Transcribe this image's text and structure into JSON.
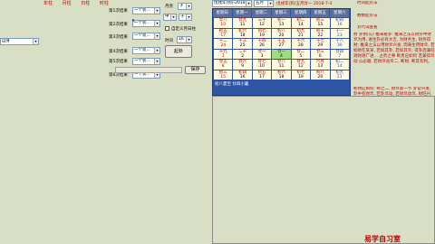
{
  "top_labels": [
    "年柱",
    "月柱",
    "日柱",
    "时柱"
  ],
  "self_select": "自身",
  "rows": [
    {
      "label": "第1次结果",
      "value": "一个装..."
    },
    {
      "label": "第2次结果",
      "value": "一个装..."
    },
    {
      "label": "第3次结果",
      "value": "一个装..."
    },
    {
      "label": "第4次结果",
      "value": "一个装..."
    },
    {
      "label": "第5次结果",
      "value": "一个装..."
    },
    {
      "label": "第6次结果",
      "value": "一个装..."
    }
  ],
  "month_label": "月亮",
  "month_value": "子",
  "day_value": "申",
  "day2_value": "子",
  "custom_checkbox": "自定义月日柱",
  "hour_label": "时间",
  "hour_value": "16",
  "qigua_button": "起卦",
  "save_button": "保存",
  "calendar": {
    "year_select": "戊戌年(狗)-2018",
    "month_select": "五月",
    "header_text": "戊戌年(狗)五月廿一  2018-7-4",
    "weekdays": [
      "星期日",
      "星期一",
      "星期二",
      "星期三",
      "星期四",
      "星期五",
      "星期六"
    ],
    "cells": [
      {
        "l": "廿八",
        "d": "10"
      },
      {
        "l": "廿九",
        "d": "11"
      },
      {
        "l": "三十",
        "d": "12"
      },
      {
        "l": "初一",
        "d": "13"
      },
      {
        "l": "初二",
        "d": "14"
      },
      {
        "l": "初三",
        "d": "15"
      },
      {
        "l": "初四",
        "d": "16"
      },
      {
        "l": "初五",
        "d": "17"
      },
      {
        "l": "初六",
        "d": "18"
      },
      {
        "l": "初七",
        "d": "19"
      },
      {
        "l": "初八",
        "d": "20"
      },
      {
        "l": "初九",
        "d": "21"
      },
      {
        "l": "初十",
        "d": "22"
      },
      {
        "l": "十一",
        "d": "23"
      },
      {
        "l": "十二",
        "d": "24"
      },
      {
        "l": "十三",
        "d": "25"
      },
      {
        "l": "十四",
        "d": "26"
      },
      {
        "l": "十五",
        "d": "27"
      },
      {
        "l": "十六",
        "d": "28"
      },
      {
        "l": "十七",
        "d": "29"
      },
      {
        "l": "十八",
        "d": "30"
      },
      {
        "l": "十九",
        "d": "1"
      },
      {
        "l": "二十",
        "d": "2"
      },
      {
        "l": "廿一",
        "d": "3"
      },
      {
        "l": "廿一",
        "d": "4"
      },
      {
        "l": "廿二",
        "d": "5"
      },
      {
        "l": "廿三",
        "d": "6"
      },
      {
        "l": "廿四",
        "d": "7"
      },
      {
        "l": "廿五",
        "d": "8"
      },
      {
        "l": "廿六",
        "d": "9"
      },
      {
        "l": "廿七",
        "d": "10"
      },
      {
        "l": "廿八",
        "d": "11"
      },
      {
        "l": "廿九",
        "d": "12"
      },
      {
        "l": "六月",
        "d": "13"
      },
      {
        "l": "初二",
        "d": "14"
      },
      {
        "l": "初三",
        "d": "15"
      },
      {
        "l": "初四",
        "d": "16"
      },
      {
        "l": "初五",
        "d": "17"
      },
      {
        "l": "初六",
        "d": "18"
      },
      {
        "l": "初七",
        "d": "19"
      },
      {
        "l": "初八",
        "d": "20"
      },
      {
        "l": "初九",
        "d": "21"
      }
    ],
    "footer": "初八夏至   廿四小暑"
  },
  "right_panel": {
    "title1": "时间起卦法",
    "title2": "数数起卦法",
    "title3": "卦代词查看",
    "body_text": "财 卦例(公) 推来看卦: 推来之法以财卦中财爻为用, 进生卦必有大吉, 为财务生, 财务得财; 推来之法以用财爻兴发, 而来生用财爻, 若如财在某某, 若如其卦, 若如其爻; 得卦后兼旺则财源广进... 占贵之事 断贵应如何 若兼得爻动 公必顺, 若财爻动爻二, 断财, 断其有利。",
    "body_text2": "断财应如何: 断之二, 财爻第一节 卦官兴发, 卦中有财爻, 若卦爻动, 若财爻动爻, 财旺兴, 若有应, 则进财而得官, 财生于官, 则财必有所得; 卦中有官爻, 若卦爻动, 则兴而大得财运。",
    "brand": "易学自习室"
  }
}
